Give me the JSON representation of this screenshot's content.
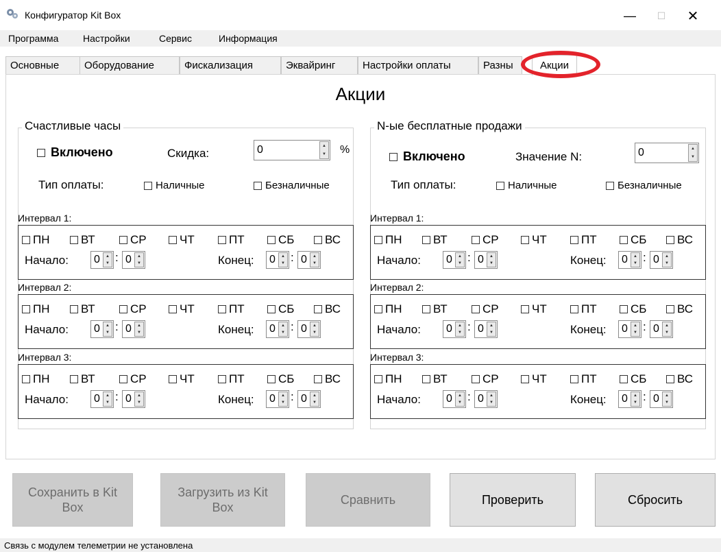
{
  "window": {
    "title": "Конфигуратор Kit Box",
    "controls": {
      "minimize": "—",
      "maximize": "☐",
      "close": "✕"
    }
  },
  "menu": [
    "Программа",
    "Настройки",
    "Сервис",
    "Информация"
  ],
  "tabs": [
    {
      "label": "Основные",
      "active": false
    },
    {
      "label": "Оборудование",
      "active": false
    },
    {
      "label": "Фискализация",
      "active": false
    },
    {
      "label": "Эквайринг",
      "active": false
    },
    {
      "label": "Настройки оплаты",
      "active": false
    },
    {
      "label": "Разны",
      "active": false
    },
    {
      "label": "Акции",
      "active": true
    }
  ],
  "highlight_color": "#e3232b",
  "section_title": "Акции",
  "groups": [
    {
      "legend": "Счастливые часы",
      "enabled_label": "Включено",
      "value_label": "Скидка:",
      "value": "0",
      "unit": "%",
      "payment_label": "Тип оплаты:",
      "cash_label": "Наличные",
      "cashless_label": "Безналичные",
      "intervals": [
        {
          "title": "Интервал 1:",
          "start_label": "Начало:",
          "end_label": "Конец:",
          "start_h": "0",
          "start_m": "0",
          "end_h": "0",
          "end_m": "0"
        },
        {
          "title": "Интервал 2:",
          "start_label": "Начало:",
          "end_label": "Конец:",
          "start_h": "0",
          "start_m": "0",
          "end_h": "0",
          "end_m": "0"
        },
        {
          "title": "Интервал 3:",
          "start_label": "Начало:",
          "end_label": "Конец:",
          "start_h": "0",
          "start_m": "0",
          "end_h": "0",
          "end_m": "0"
        }
      ]
    },
    {
      "legend": "N-ые бесплатные продажи",
      "enabled_label": "Включено",
      "value_label": "Значение N:",
      "value": "0",
      "unit": "",
      "payment_label": "Тип оплаты:",
      "cash_label": "Наличные",
      "cashless_label": "Безналичные",
      "intervals": [
        {
          "title": "Интервал 1:",
          "start_label": "Начало:",
          "end_label": "Конец:",
          "start_h": "0",
          "start_m": "0",
          "end_h": "0",
          "end_m": "0"
        },
        {
          "title": "Интервал 2:",
          "start_label": "Начало:",
          "end_label": "Конец:",
          "start_h": "0",
          "start_m": "0",
          "end_h": "0",
          "end_m": "0"
        },
        {
          "title": "Интервал 3:",
          "start_label": "Начало:",
          "end_label": "Конец:",
          "start_h": "0",
          "start_m": "0",
          "end_h": "0",
          "end_m": "0"
        }
      ]
    }
  ],
  "days": [
    "ПН",
    "ВТ",
    "СР",
    "ЧТ",
    "ПТ",
    "СБ",
    "ВС"
  ],
  "time_separator": ":",
  "buttons": [
    {
      "label": "Сохранить в Kit Box",
      "enabled": false
    },
    {
      "label": "Загрузить из Kit Box",
      "enabled": false
    },
    {
      "label": "Сравнить",
      "enabled": false
    },
    {
      "label": "Проверить",
      "enabled": true
    },
    {
      "label": "Сбросить",
      "enabled": true
    }
  ],
  "status": "Связь с модулем телеметрии не установлена"
}
